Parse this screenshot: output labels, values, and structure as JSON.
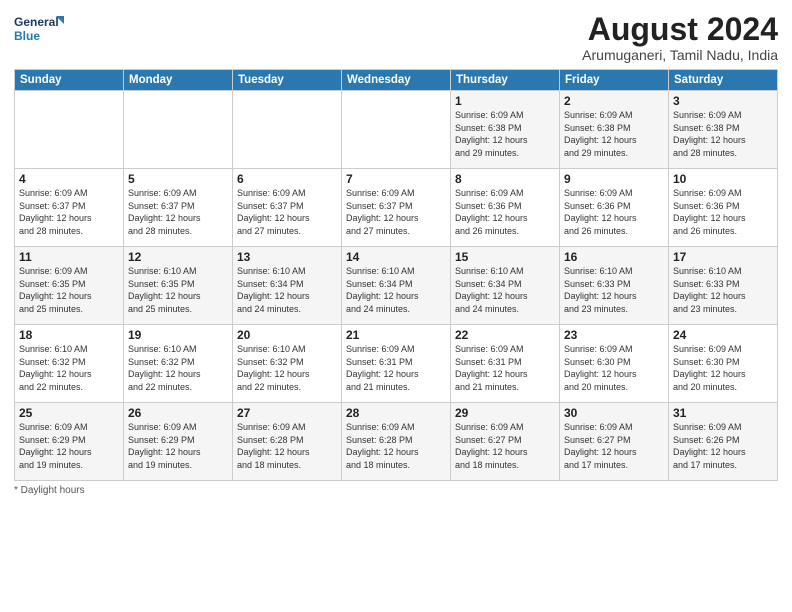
{
  "logo": {
    "line1": "General",
    "line2": "Blue"
  },
  "title": "August 2024",
  "subtitle": "Arumuganeri, Tamil Nadu, India",
  "days_of_week": [
    "Sunday",
    "Monday",
    "Tuesday",
    "Wednesday",
    "Thursday",
    "Friday",
    "Saturday"
  ],
  "weeks": [
    [
      {
        "day": "",
        "info": ""
      },
      {
        "day": "",
        "info": ""
      },
      {
        "day": "",
        "info": ""
      },
      {
        "day": "",
        "info": ""
      },
      {
        "day": "1",
        "info": "Sunrise: 6:09 AM\nSunset: 6:38 PM\nDaylight: 12 hours\nand 29 minutes."
      },
      {
        "day": "2",
        "info": "Sunrise: 6:09 AM\nSunset: 6:38 PM\nDaylight: 12 hours\nand 29 minutes."
      },
      {
        "day": "3",
        "info": "Sunrise: 6:09 AM\nSunset: 6:38 PM\nDaylight: 12 hours\nand 28 minutes."
      }
    ],
    [
      {
        "day": "4",
        "info": "Sunrise: 6:09 AM\nSunset: 6:37 PM\nDaylight: 12 hours\nand 28 minutes."
      },
      {
        "day": "5",
        "info": "Sunrise: 6:09 AM\nSunset: 6:37 PM\nDaylight: 12 hours\nand 28 minutes."
      },
      {
        "day": "6",
        "info": "Sunrise: 6:09 AM\nSunset: 6:37 PM\nDaylight: 12 hours\nand 27 minutes."
      },
      {
        "day": "7",
        "info": "Sunrise: 6:09 AM\nSunset: 6:37 PM\nDaylight: 12 hours\nand 27 minutes."
      },
      {
        "day": "8",
        "info": "Sunrise: 6:09 AM\nSunset: 6:36 PM\nDaylight: 12 hours\nand 26 minutes."
      },
      {
        "day": "9",
        "info": "Sunrise: 6:09 AM\nSunset: 6:36 PM\nDaylight: 12 hours\nand 26 minutes."
      },
      {
        "day": "10",
        "info": "Sunrise: 6:09 AM\nSunset: 6:36 PM\nDaylight: 12 hours\nand 26 minutes."
      }
    ],
    [
      {
        "day": "11",
        "info": "Sunrise: 6:09 AM\nSunset: 6:35 PM\nDaylight: 12 hours\nand 25 minutes."
      },
      {
        "day": "12",
        "info": "Sunrise: 6:10 AM\nSunset: 6:35 PM\nDaylight: 12 hours\nand 25 minutes."
      },
      {
        "day": "13",
        "info": "Sunrise: 6:10 AM\nSunset: 6:34 PM\nDaylight: 12 hours\nand 24 minutes."
      },
      {
        "day": "14",
        "info": "Sunrise: 6:10 AM\nSunset: 6:34 PM\nDaylight: 12 hours\nand 24 minutes."
      },
      {
        "day": "15",
        "info": "Sunrise: 6:10 AM\nSunset: 6:34 PM\nDaylight: 12 hours\nand 24 minutes."
      },
      {
        "day": "16",
        "info": "Sunrise: 6:10 AM\nSunset: 6:33 PM\nDaylight: 12 hours\nand 23 minutes."
      },
      {
        "day": "17",
        "info": "Sunrise: 6:10 AM\nSunset: 6:33 PM\nDaylight: 12 hours\nand 23 minutes."
      }
    ],
    [
      {
        "day": "18",
        "info": "Sunrise: 6:10 AM\nSunset: 6:32 PM\nDaylight: 12 hours\nand 22 minutes."
      },
      {
        "day": "19",
        "info": "Sunrise: 6:10 AM\nSunset: 6:32 PM\nDaylight: 12 hours\nand 22 minutes."
      },
      {
        "day": "20",
        "info": "Sunrise: 6:10 AM\nSunset: 6:32 PM\nDaylight: 12 hours\nand 22 minutes."
      },
      {
        "day": "21",
        "info": "Sunrise: 6:09 AM\nSunset: 6:31 PM\nDaylight: 12 hours\nand 21 minutes."
      },
      {
        "day": "22",
        "info": "Sunrise: 6:09 AM\nSunset: 6:31 PM\nDaylight: 12 hours\nand 21 minutes."
      },
      {
        "day": "23",
        "info": "Sunrise: 6:09 AM\nSunset: 6:30 PM\nDaylight: 12 hours\nand 20 minutes."
      },
      {
        "day": "24",
        "info": "Sunrise: 6:09 AM\nSunset: 6:30 PM\nDaylight: 12 hours\nand 20 minutes."
      }
    ],
    [
      {
        "day": "25",
        "info": "Sunrise: 6:09 AM\nSunset: 6:29 PM\nDaylight: 12 hours\nand 19 minutes."
      },
      {
        "day": "26",
        "info": "Sunrise: 6:09 AM\nSunset: 6:29 PM\nDaylight: 12 hours\nand 19 minutes."
      },
      {
        "day": "27",
        "info": "Sunrise: 6:09 AM\nSunset: 6:28 PM\nDaylight: 12 hours\nand 18 minutes."
      },
      {
        "day": "28",
        "info": "Sunrise: 6:09 AM\nSunset: 6:28 PM\nDaylight: 12 hours\nand 18 minutes."
      },
      {
        "day": "29",
        "info": "Sunrise: 6:09 AM\nSunset: 6:27 PM\nDaylight: 12 hours\nand 18 minutes."
      },
      {
        "day": "30",
        "info": "Sunrise: 6:09 AM\nSunset: 6:27 PM\nDaylight: 12 hours\nand 17 minutes."
      },
      {
        "day": "31",
        "info": "Sunrise: 6:09 AM\nSunset: 6:26 PM\nDaylight: 12 hours\nand 17 minutes."
      }
    ]
  ],
  "footer": "Daylight hours"
}
